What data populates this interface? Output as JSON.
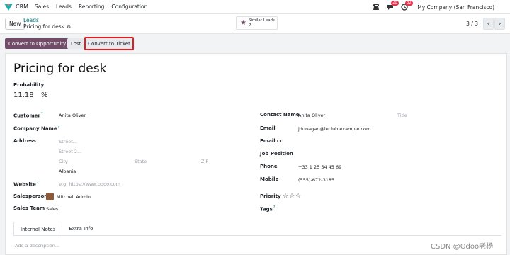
{
  "topbar": {
    "app_name": "CRM",
    "menu": [
      "Sales",
      "Leads",
      "Reporting",
      "Configuration"
    ],
    "chat_count": "20",
    "activity_count": "32",
    "company": "My Company (San Francisco)"
  },
  "control": {
    "new_label": "New",
    "breadcrumb_parent": "Leads",
    "breadcrumb_current": "Pricing for desk",
    "similar_label": "Similar Leads",
    "similar_count": "2",
    "pager": "3 / 3"
  },
  "actions": {
    "convert_opportunity": "Convert to Opportunity",
    "lost": "Lost",
    "convert_ticket": "Convert to Ticket"
  },
  "form": {
    "title": "Pricing for desk",
    "probability_label": "Probability",
    "probability_value": "11.18",
    "probability_unit": "%",
    "customer_label": "Customer",
    "customer_value": "Anita Oliver",
    "company_name_label": "Company Name",
    "address_label": "Address",
    "street_ph": "Street...",
    "street2_ph": "Street 2...",
    "city_ph": "City",
    "state_ph": "State",
    "zip_ph": "ZIP",
    "country": "Albania",
    "website_label": "Website",
    "website_ph": "e.g. https://www.odoo.com",
    "salesperson_label": "Salesperson",
    "salesperson_value": "Mitchell Admin",
    "sales_team_label": "Sales Team",
    "sales_team_value": "Sales",
    "contact_name_label": "Contact Name",
    "contact_name_value": "Anita Oliver",
    "title_ph": "Title",
    "email_label": "Email",
    "email_value": "jdunagan@leclub.example.com",
    "email_cc_label": "Email cc",
    "job_position_label": "Job Position",
    "phone_label": "Phone",
    "phone_value": "+33 1 25 54 45 69",
    "mobile_label": "Mobile",
    "mobile_value": "(555)-672-3185",
    "priority_label": "Priority",
    "priority_stars": 0,
    "tags_label": "Tags"
  },
  "tabs": [
    "Internal Notes",
    "Extra Info"
  ],
  "description_ph": "Add a description...",
  "watermark": "CSDN @Odoo老杨"
}
